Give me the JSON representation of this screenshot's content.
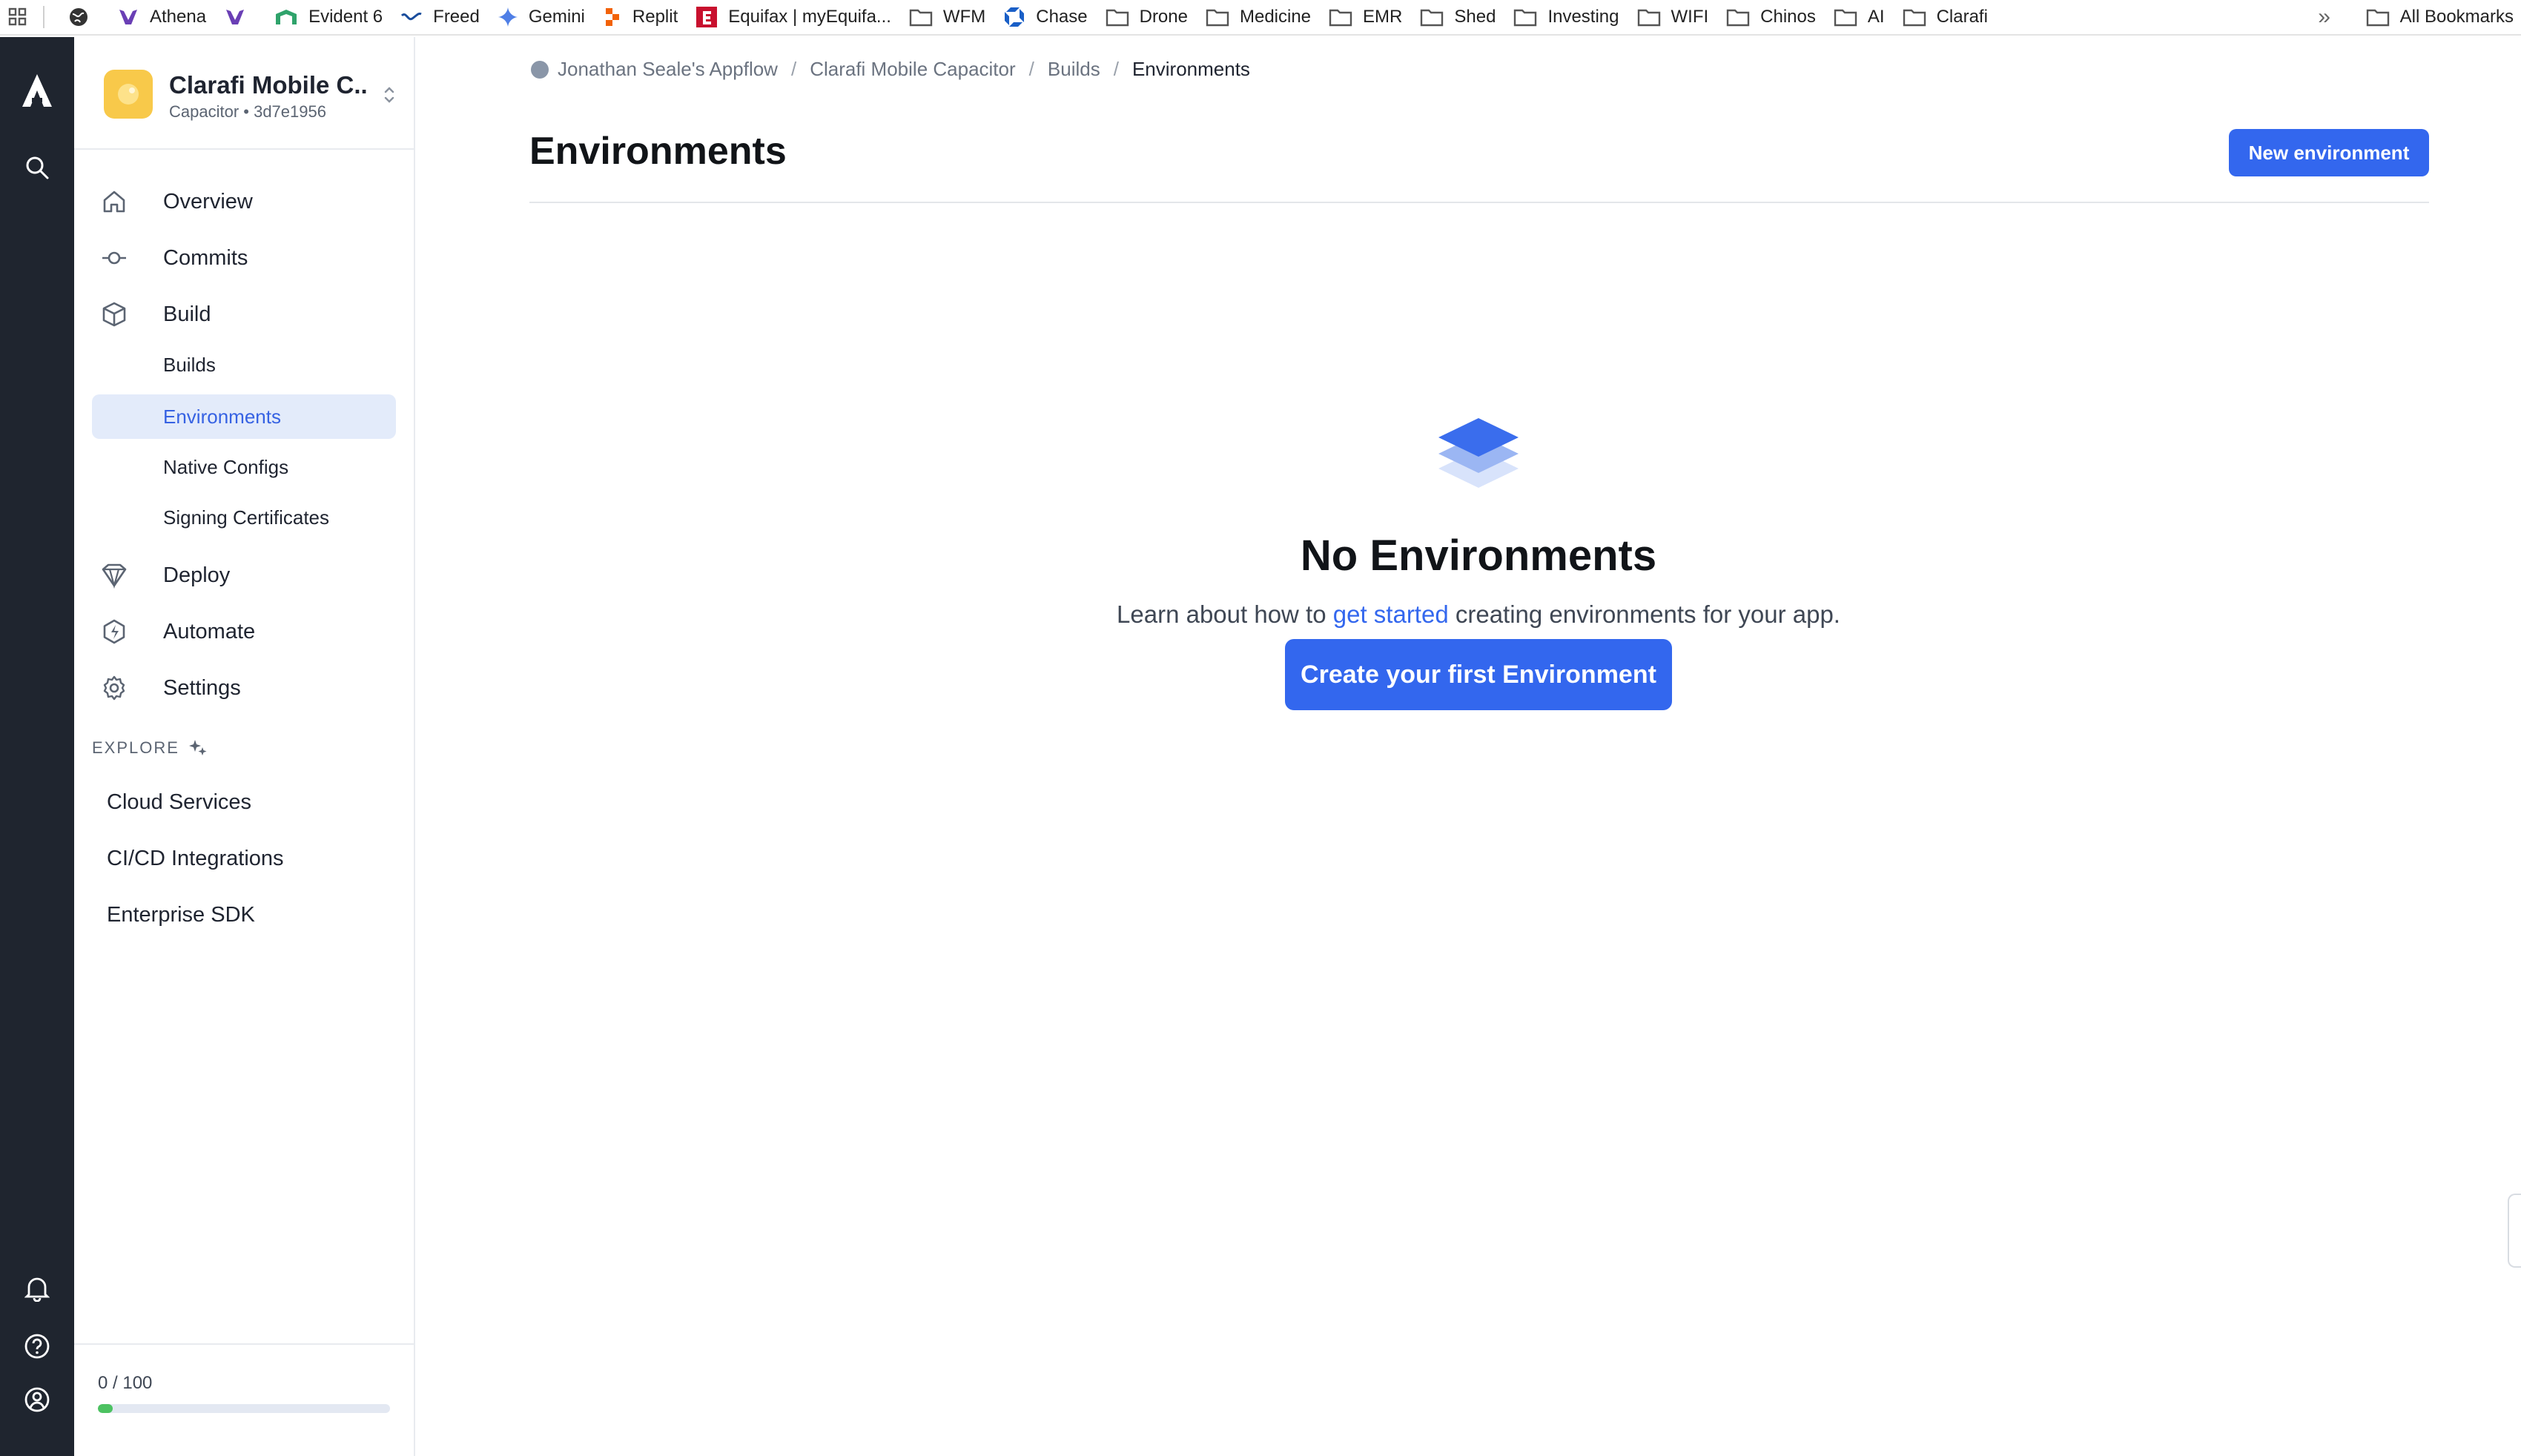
{
  "bookmarks": {
    "items": [
      {
        "label": "",
        "icon": "globe-icon"
      },
      {
        "label": "Athena",
        "icon": "athena-icon"
      },
      {
        "label": "",
        "icon": "athena-icon"
      },
      {
        "label": "Evident 6",
        "icon": "evident-icon"
      },
      {
        "label": "Freed",
        "icon": "freed-icon"
      },
      {
        "label": "Gemini",
        "icon": "gemini-icon"
      },
      {
        "label": "Replit",
        "icon": "replit-icon"
      },
      {
        "label": "Equifax | myEquifa...",
        "icon": "equifax-icon"
      },
      {
        "label": "WFM",
        "icon": "folder-icon"
      },
      {
        "label": "Chase",
        "icon": "chase-icon"
      },
      {
        "label": "Drone",
        "icon": "folder-icon"
      },
      {
        "label": "Medicine",
        "icon": "folder-icon"
      },
      {
        "label": "EMR",
        "icon": "folder-icon"
      },
      {
        "label": "Shed",
        "icon": "folder-icon"
      },
      {
        "label": "Investing",
        "icon": "folder-icon"
      },
      {
        "label": "WIFI",
        "icon": "folder-icon"
      },
      {
        "label": "Chinos",
        "icon": "folder-icon"
      },
      {
        "label": "AI",
        "icon": "folder-icon"
      },
      {
        "label": "Clarafi",
        "icon": "folder-icon"
      }
    ],
    "more": "»",
    "all_label": "All Bookmarks"
  },
  "app": {
    "name": "Clarafi Mobile C...",
    "subtitle": "Capacitor • 3d7e1956"
  },
  "nav": {
    "overview": "Overview",
    "commits": "Commits",
    "build": "Build",
    "builds": "Builds",
    "environments": "Environments",
    "native_configs": "Native Configs",
    "signing_certificates": "Signing Certificates",
    "deploy": "Deploy",
    "automate": "Automate",
    "settings": "Settings"
  },
  "explore": {
    "heading": "EXPLORE",
    "items": [
      "Cloud Services",
      "CI/CD Integrations",
      "Enterprise SDK"
    ]
  },
  "usage": {
    "text": "0 / 100",
    "fill_fraction": 0.05,
    "color": "#4cc261"
  },
  "breadcrumb": {
    "org": "Jonathan Seale's Appflow",
    "app": "Clarafi Mobile Capacitor",
    "section": "Builds",
    "current": "Environments",
    "separator": "/"
  },
  "page": {
    "title": "Environments",
    "new_button": "New environment"
  },
  "empty": {
    "title": "No Environments",
    "desc_before": "Learn about how to ",
    "desc_link": "get started",
    "desc_after": " creating environments for your app.",
    "button": "Create your first Environment"
  },
  "colors": {
    "accent": "#3367ee",
    "rail": "#1f252f",
    "active_bg": "#e3ebfa",
    "app_icon": "#f8c94a"
  }
}
